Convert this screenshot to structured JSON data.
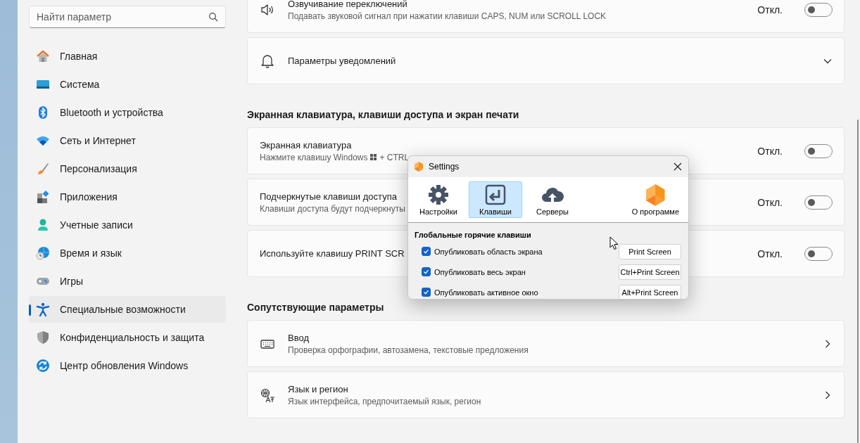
{
  "sidebar": {
    "search": {
      "placeholder": "Найти параметр"
    },
    "items": [
      {
        "label": "Главная",
        "selected": false
      },
      {
        "label": "Система",
        "selected": false
      },
      {
        "label": "Bluetooth и устройства",
        "selected": false
      },
      {
        "label": "Сеть и Интернет",
        "selected": false
      },
      {
        "label": "Персонализация",
        "selected": false
      },
      {
        "label": "Приложения",
        "selected": false
      },
      {
        "label": "Учетные записи",
        "selected": false
      },
      {
        "label": "Время и язык",
        "selected": false
      },
      {
        "label": "Игры",
        "selected": false
      },
      {
        "label": "Специальные возможности",
        "selected": true
      },
      {
        "label": "Конфиденциальность и защита",
        "selected": false
      },
      {
        "label": "Центр обновления Windows",
        "selected": false
      }
    ]
  },
  "main": {
    "sections": [
      {
        "cards": [
          {
            "kind": "toggle",
            "title": "Озвучивание переключений",
            "subtitle": "Подавать звуковой сигнал при нажатии клавиши CAPS, NUM или SCROLL LOCK",
            "state": "Откл.",
            "on": false
          },
          {
            "kind": "expander",
            "title": "Параметры уведомлений"
          }
        ]
      },
      {
        "heading": "Экранная клавиатура, клавиши доступа и экран печати",
        "cards": [
          {
            "kind": "toggle",
            "title": "Экранная клавиатура",
            "subtitle": "Нажмите клавишу Windows",
            "subtitle_after_icon": "+ CTRL",
            "state": "Откл.",
            "on": false
          },
          {
            "kind": "toggle",
            "title": "Подчеркнутые клавиши доступа",
            "subtitle": "Клавиши доступа будут подчеркнуты",
            "state": "Откл.",
            "on": false
          },
          {
            "kind": "toggle",
            "title": "Используйте клавишу PRINT SCR",
            "state": "Откл.",
            "on": false
          }
        ]
      },
      {
        "heading": "Сопутствующие параметры",
        "cards": [
          {
            "kind": "link",
            "title": "Ввод",
            "subtitle": "Проверка орфографии, автозамена, текстовые предложения"
          },
          {
            "kind": "link",
            "title": "Язык и регион",
            "subtitle": "Язык интерфейса, предпочитаемый язык, регион"
          }
        ]
      }
    ]
  },
  "dialog": {
    "title": "Settings",
    "tabs": [
      {
        "label": "Настройки",
        "selected": false
      },
      {
        "label": "Клавиши",
        "selected": true
      },
      {
        "label": "Серверы",
        "selected": false
      },
      {
        "label": "О программе",
        "selected": false
      }
    ],
    "section_title": "Глобальные горячие клавиши",
    "hotkeys": [
      {
        "label": "Опубликовать область экрана",
        "checked": true,
        "key": "Print Screen"
      },
      {
        "label": "Опубликовать весь экран",
        "checked": true,
        "key": "Ctrl+Print Screen"
      },
      {
        "label": "Опубликовать активное окно",
        "checked": true,
        "key": "Alt+Print Screen"
      }
    ]
  }
}
